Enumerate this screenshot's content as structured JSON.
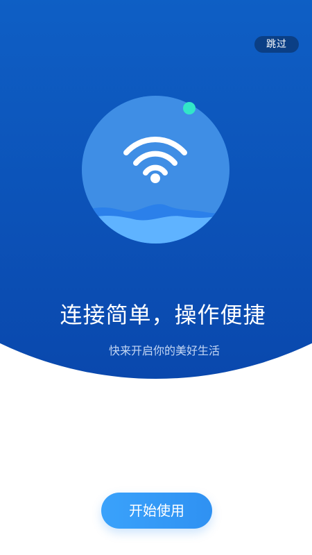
{
  "header": {
    "skip_label": "跳过"
  },
  "hero": {
    "illustration_icon": "wifi-icon",
    "headline": "连接简单，操作便捷",
    "subtitle": "快来开启你的美好生活"
  },
  "footer": {
    "start_label": "开始使用"
  },
  "colors": {
    "hero_top": "#1174d6",
    "hero_bottom": "#0a48ad",
    "skip_bg": "#0b3f85",
    "circle_fill": "#3f8ee5",
    "wave_light": "#5fb3ff",
    "wave_dark": "#2b80ea",
    "accent_dot": "#32e6c8",
    "button_start": "#3aa2fb",
    "button_end": "#2f91f2"
  }
}
